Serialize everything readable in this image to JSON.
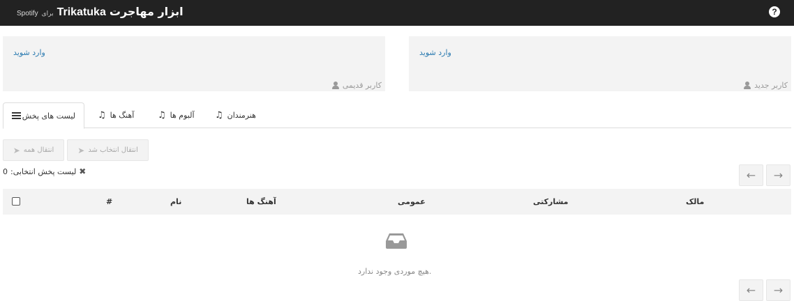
{
  "header": {
    "app_title_fa": "ابزار مهاجرت",
    "app_title_en": "Trikatuka",
    "for_label": "برای",
    "spotify_label": "Spotify",
    "help_icon": "question-circle-icon",
    "help_glyph": "?"
  },
  "accounts": {
    "old_user": {
      "login_label": "وارد شوید",
      "role_label": "کاربر قدیمی",
      "icon": "user-icon"
    },
    "new_user": {
      "login_label": "وارد شوید",
      "role_label": "کاربر جدید",
      "icon": "user-icon"
    }
  },
  "tabs": [
    {
      "label": "لیست های پخش",
      "icon": "list-icon",
      "active": true
    },
    {
      "label": "آهنگ ها",
      "icon": "music-icon",
      "active": false
    },
    {
      "label": "آلبوم ها",
      "icon": "music-icon",
      "active": false
    },
    {
      "label": "هنرمندان",
      "icon": "music-icon",
      "active": false
    }
  ],
  "actions": {
    "transfer_all_label": "انتقال همه",
    "transfer_selected_label": "انتقال انتخاب شد",
    "send_icon": "paper-plane-icon"
  },
  "selection": {
    "label": "لیست پخش انتخابی:",
    "count": "0",
    "clear_icon": "times-icon"
  },
  "pagination": {
    "prev_glyph": "←",
    "next_glyph": "→"
  },
  "table": {
    "columns": {
      "number": "#",
      "name": "نام",
      "tracks": "آهنگ ها",
      "public": "عمومی",
      "collaborative": "مشارکتی",
      "owner": "مالک"
    },
    "empty_icon": "inbox-icon",
    "empty_text": ".هیچ موردی وجود ندارد"
  },
  "colors": {
    "topbar": "#222222",
    "panel_bg": "#f3f3f3",
    "link": "#2a7ab0"
  }
}
